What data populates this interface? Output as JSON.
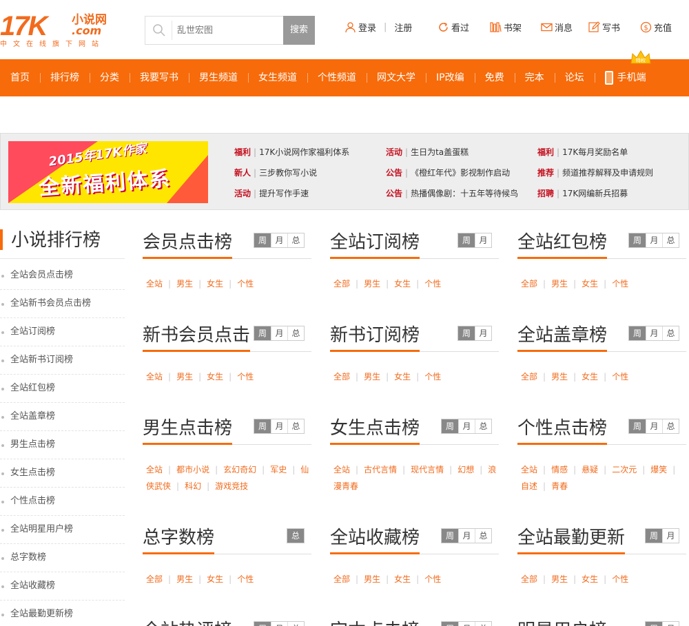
{
  "logo": {
    "big": "17K",
    "cn": "小说网",
    "com": ".com",
    "slogan": "中文在线旗下网站"
  },
  "search": {
    "placeholder": "乱世宏图",
    "button": "搜索"
  },
  "toplinks": {
    "login": "登录",
    "register": "注册",
    "history": "看过",
    "shelf": "书架",
    "messages": "消息",
    "write": "写书",
    "recharge": "充值"
  },
  "nav": {
    "items": [
      "首页",
      "排行榜",
      "分类",
      "我要写书",
      "男生频道",
      "女生频道",
      "个性频道",
      "网文大学",
      "IP改编",
      "免费",
      "完本",
      "论坛"
    ],
    "mobile": "手机端",
    "crown_text": "特权"
  },
  "promo": {
    "banner_line1": "2015年17K作家",
    "banner_line2": "全新福利体系",
    "news": [
      {
        "tag": "福利",
        "text": "17K小说网作家福利体系"
      },
      {
        "tag": "活动",
        "text": "生日为ta盖蛋糕"
      },
      {
        "tag": "福利",
        "text": "17K每月奖励名单"
      },
      {
        "tag": "新人",
        "text": "三步教你写小说"
      },
      {
        "tag": "公告",
        "text": "《橙红年代》影视制作启动"
      },
      {
        "tag": "推荐",
        "text": "频道推荐解释及申请规则"
      },
      {
        "tag": "活动",
        "text": "提升写作手速"
      },
      {
        "tag": "公告",
        "text": "热播偶像剧：十五年等待候鸟"
      },
      {
        "tag": "招聘",
        "text": "17K网编新兵招募"
      }
    ]
  },
  "sidebar": {
    "title": "小说排行榜",
    "items": [
      "全站会员点击榜",
      "全站新书会员点击榜",
      "全站订阅榜",
      "全站新书订阅榜",
      "全站红包榜",
      "全站盖章榜",
      "男生点击榜",
      "女生点击榜",
      "个性点击榜",
      "全站明星用户榜",
      "总字数榜",
      "全站收藏榜",
      "全站最勤更新榜"
    ]
  },
  "boxes": [
    {
      "title": "会员点击榜",
      "tabs": [
        "周",
        "月",
        "总"
      ],
      "links": [
        "全站",
        "男生",
        "女生",
        "个性"
      ]
    },
    {
      "title": "全站订阅榜",
      "tabs": [
        "周",
        "月"
      ],
      "links": [
        "全部",
        "男生",
        "女生",
        "个性"
      ]
    },
    {
      "title": "全站红包榜",
      "tabs": [
        "周",
        "月",
        "总"
      ],
      "links": [
        "全部",
        "男生",
        "女生",
        "个性"
      ]
    },
    {
      "title": "新书会员点击",
      "tabs": [
        "周",
        "月",
        "总"
      ],
      "links": [
        "全站",
        "男生",
        "女生",
        "个性"
      ]
    },
    {
      "title": "新书订阅榜",
      "tabs": [
        "周",
        "月"
      ],
      "links": [
        "全部",
        "男生",
        "女生",
        "个性"
      ]
    },
    {
      "title": "全站盖章榜",
      "tabs": [
        "周",
        "月",
        "总"
      ],
      "links": [
        "全部",
        "男生",
        "女生",
        "个性"
      ]
    },
    {
      "title": "男生点击榜",
      "tabs": [
        "周",
        "月",
        "总"
      ],
      "links": [
        "全站",
        "都市小说",
        "玄幻奇幻",
        "军史",
        "仙侠武侠",
        "科幻",
        "游戏竞技"
      ]
    },
    {
      "title": "女生点击榜",
      "tabs": [
        "周",
        "月",
        "总"
      ],
      "links": [
        "全站",
        "古代言情",
        "现代言情",
        "幻想",
        "浪漫青春"
      ]
    },
    {
      "title": "个性点击榜",
      "tabs": [
        "周",
        "月",
        "总"
      ],
      "links": [
        "全站",
        "情感",
        "悬疑",
        "二次元",
        "爆笑",
        "自述",
        "青春"
      ]
    },
    {
      "title": "总字数榜",
      "tabs": [
        "总"
      ],
      "links": [
        "全部",
        "男生",
        "女生",
        "个性"
      ]
    },
    {
      "title": "全站收藏榜",
      "tabs": [
        "周",
        "月",
        "总"
      ],
      "links": [
        "全部",
        "男生",
        "女生",
        "个性"
      ]
    },
    {
      "title": "全站最勤更新",
      "tabs": [
        "周",
        "月"
      ],
      "links": [
        "全部",
        "男生",
        "女生",
        "个性"
      ]
    },
    {
      "title": "全站热评榜",
      "tabs": [
        "周",
        "月",
        "总"
      ],
      "links": []
    },
    {
      "title": "完本点击榜",
      "tabs": [
        "周",
        "月",
        "总"
      ],
      "links": []
    },
    {
      "title": "明星用户榜",
      "tabs": [
        "周",
        "月"
      ],
      "links": []
    }
  ],
  "colors": {
    "brand": "#f76b0a",
    "tag_red": "#c4101e",
    "link_orange": "#f26b1d"
  }
}
